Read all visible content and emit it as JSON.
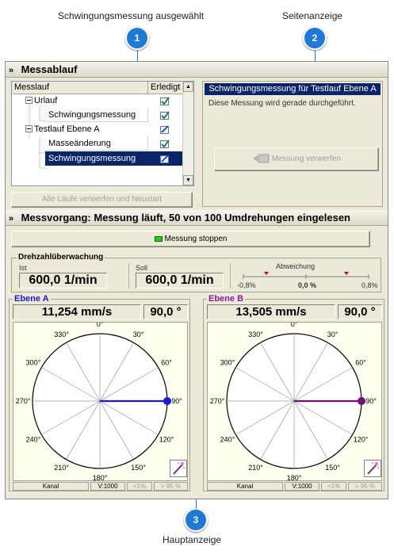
{
  "callouts": [
    {
      "number": "1",
      "label": "Schwingungsmessung ausgewählt"
    },
    {
      "number": "2",
      "label": "Seitenanzeige"
    },
    {
      "number": "3",
      "label": "Hauptanzeige"
    }
  ],
  "messablauf": {
    "title": "Messablauf",
    "columns": {
      "name": "Messlauf",
      "done": "Erledigt"
    },
    "rows": [
      {
        "label": "Urlauf",
        "toggle": "−"
      },
      {
        "label": "Schwingungsmessung"
      },
      {
        "label": "Testlauf Ebene A",
        "toggle": "−"
      },
      {
        "label": "Masseänderung"
      },
      {
        "label": "Schwingungsmessung",
        "selected": true
      }
    ],
    "reset_button": "Alle Läufe verwerfen und Neustart"
  },
  "side_panel": {
    "title": "Schwingungsmessung für Testlauf Ebene A",
    "message": "Diese Messung wird gerade durchgeführt.",
    "discard_button": "Messung verwerfen"
  },
  "messvorgang": {
    "title": "Messvorgang: Messung läuft, 50 von 100 Umdrehungen eingelesen",
    "stop_button": "Messung stoppen",
    "status_led_color": "#22cc22"
  },
  "drehzahl": {
    "title": "Drehzahlüberwachung",
    "ist_label": "Ist",
    "ist_value": "600,0 1/min",
    "soll_label": "Soll",
    "soll_value": "600,0 1/min",
    "abweichung_label": "Abweichung",
    "scale_min": "-0,8%",
    "scale_mid": "0,0 %",
    "scale_max": "0,8%"
  },
  "planes": [
    {
      "title": "Ebene A",
      "amplitude": "11,254 mm/s",
      "angle": "90,0 °",
      "angle_deg": 90,
      "color": "#1a1adc",
      "title_color": "#1a1acc",
      "status": {
        "kanal": "Kanal",
        "v": "V:1000",
        "q1": "<1%",
        "q2": "> 95 %"
      }
    },
    {
      "title": "Ebene B",
      "amplitude": "13,505 mm/s",
      "angle": "90,0 °",
      "angle_deg": 90,
      "color": "#7a0a7a",
      "title_color": "#8a1a9a",
      "status": {
        "kanal": "Kanal",
        "v": "V:1000",
        "q1": "<1%",
        "q2": "> 95 %"
      }
    }
  ],
  "angle_labels": [
    "0°",
    "30°",
    "60°",
    "90°",
    "120°",
    "150°",
    "180°",
    "210°",
    "240°",
    "270°",
    "300°",
    "330°"
  ]
}
